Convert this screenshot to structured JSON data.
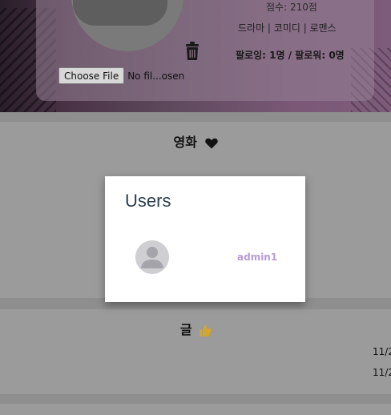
{
  "profile": {
    "score_label": "점수: 210점",
    "genres": "드라마 | 코미디 | 로맨스",
    "follow": "팔로잉: 1명 / 팔로워: 0명",
    "file_button": "Choose File",
    "file_name": "No fil...osen"
  },
  "movie_section": {
    "title": "영화",
    "icon": "heart-icon"
  },
  "posts_section": {
    "title": "글",
    "icon": "thumbs-up-icon",
    "dates": [
      "11/2",
      "11/2"
    ]
  },
  "modal": {
    "title": "Users",
    "users": [
      {
        "name": "admin1",
        "avatar": "default-user-avatar"
      }
    ]
  },
  "colors": {
    "username": "#b89ad6",
    "modal_title": "#2c3e50",
    "thumbs_up": "#d4a62a"
  }
}
